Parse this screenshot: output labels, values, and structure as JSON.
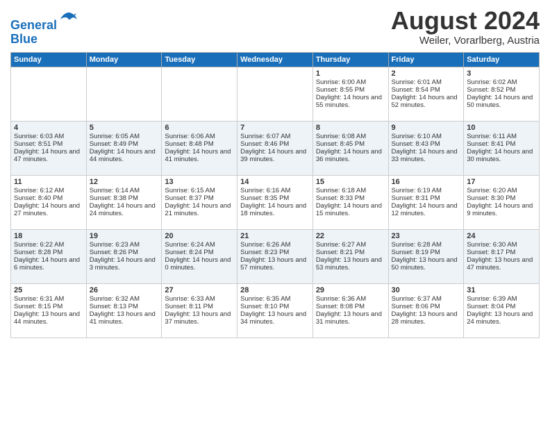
{
  "header": {
    "logo_line1": "General",
    "logo_line2": "Blue",
    "month": "August 2024",
    "location": "Weiler, Vorarlberg, Austria"
  },
  "days_of_week": [
    "Sunday",
    "Monday",
    "Tuesday",
    "Wednesday",
    "Thursday",
    "Friday",
    "Saturday"
  ],
  "weeks": [
    [
      {
        "day": "",
        "empty": true
      },
      {
        "day": "",
        "empty": true
      },
      {
        "day": "",
        "empty": true
      },
      {
        "day": "",
        "empty": true
      },
      {
        "day": "1",
        "sunrise": "Sunrise: 6:00 AM",
        "sunset": "Sunset: 8:55 PM",
        "daylight": "Daylight: 14 hours and 55 minutes."
      },
      {
        "day": "2",
        "sunrise": "Sunrise: 6:01 AM",
        "sunset": "Sunset: 8:54 PM",
        "daylight": "Daylight: 14 hours and 52 minutes."
      },
      {
        "day": "3",
        "sunrise": "Sunrise: 6:02 AM",
        "sunset": "Sunset: 8:52 PM",
        "daylight": "Daylight: 14 hours and 50 minutes."
      }
    ],
    [
      {
        "day": "4",
        "sunrise": "Sunrise: 6:03 AM",
        "sunset": "Sunset: 8:51 PM",
        "daylight": "Daylight: 14 hours and 47 minutes."
      },
      {
        "day": "5",
        "sunrise": "Sunrise: 6:05 AM",
        "sunset": "Sunset: 8:49 PM",
        "daylight": "Daylight: 14 hours and 44 minutes."
      },
      {
        "day": "6",
        "sunrise": "Sunrise: 6:06 AM",
        "sunset": "Sunset: 8:48 PM",
        "daylight": "Daylight: 14 hours and 41 minutes."
      },
      {
        "day": "7",
        "sunrise": "Sunrise: 6:07 AM",
        "sunset": "Sunset: 8:46 PM",
        "daylight": "Daylight: 14 hours and 39 minutes."
      },
      {
        "day": "8",
        "sunrise": "Sunrise: 6:08 AM",
        "sunset": "Sunset: 8:45 PM",
        "daylight": "Daylight: 14 hours and 36 minutes."
      },
      {
        "day": "9",
        "sunrise": "Sunrise: 6:10 AM",
        "sunset": "Sunset: 8:43 PM",
        "daylight": "Daylight: 14 hours and 33 minutes."
      },
      {
        "day": "10",
        "sunrise": "Sunrise: 6:11 AM",
        "sunset": "Sunset: 8:41 PM",
        "daylight": "Daylight: 14 hours and 30 minutes."
      }
    ],
    [
      {
        "day": "11",
        "sunrise": "Sunrise: 6:12 AM",
        "sunset": "Sunset: 8:40 PM",
        "daylight": "Daylight: 14 hours and 27 minutes."
      },
      {
        "day": "12",
        "sunrise": "Sunrise: 6:14 AM",
        "sunset": "Sunset: 8:38 PM",
        "daylight": "Daylight: 14 hours and 24 minutes."
      },
      {
        "day": "13",
        "sunrise": "Sunrise: 6:15 AM",
        "sunset": "Sunset: 8:37 PM",
        "daylight": "Daylight: 14 hours and 21 minutes."
      },
      {
        "day": "14",
        "sunrise": "Sunrise: 6:16 AM",
        "sunset": "Sunset: 8:35 PM",
        "daylight": "Daylight: 14 hours and 18 minutes."
      },
      {
        "day": "15",
        "sunrise": "Sunrise: 6:18 AM",
        "sunset": "Sunset: 8:33 PM",
        "daylight": "Daylight: 14 hours and 15 minutes."
      },
      {
        "day": "16",
        "sunrise": "Sunrise: 6:19 AM",
        "sunset": "Sunset: 8:31 PM",
        "daylight": "Daylight: 14 hours and 12 minutes."
      },
      {
        "day": "17",
        "sunrise": "Sunrise: 6:20 AM",
        "sunset": "Sunset: 8:30 PM",
        "daylight": "Daylight: 14 hours and 9 minutes."
      }
    ],
    [
      {
        "day": "18",
        "sunrise": "Sunrise: 6:22 AM",
        "sunset": "Sunset: 8:28 PM",
        "daylight": "Daylight: 14 hours and 6 minutes."
      },
      {
        "day": "19",
        "sunrise": "Sunrise: 6:23 AM",
        "sunset": "Sunset: 8:26 PM",
        "daylight": "Daylight: 14 hours and 3 minutes."
      },
      {
        "day": "20",
        "sunrise": "Sunrise: 6:24 AM",
        "sunset": "Sunset: 8:24 PM",
        "daylight": "Daylight: 14 hours and 0 minutes."
      },
      {
        "day": "21",
        "sunrise": "Sunrise: 6:26 AM",
        "sunset": "Sunset: 8:23 PM",
        "daylight": "Daylight: 13 hours and 57 minutes."
      },
      {
        "day": "22",
        "sunrise": "Sunrise: 6:27 AM",
        "sunset": "Sunset: 8:21 PM",
        "daylight": "Daylight: 13 hours and 53 minutes."
      },
      {
        "day": "23",
        "sunrise": "Sunrise: 6:28 AM",
        "sunset": "Sunset: 8:19 PM",
        "daylight": "Daylight: 13 hours and 50 minutes."
      },
      {
        "day": "24",
        "sunrise": "Sunrise: 6:30 AM",
        "sunset": "Sunset: 8:17 PM",
        "daylight": "Daylight: 13 hours and 47 minutes."
      }
    ],
    [
      {
        "day": "25",
        "sunrise": "Sunrise: 6:31 AM",
        "sunset": "Sunset: 8:15 PM",
        "daylight": "Daylight: 13 hours and 44 minutes."
      },
      {
        "day": "26",
        "sunrise": "Sunrise: 6:32 AM",
        "sunset": "Sunset: 8:13 PM",
        "daylight": "Daylight: 13 hours and 41 minutes."
      },
      {
        "day": "27",
        "sunrise": "Sunrise: 6:33 AM",
        "sunset": "Sunset: 8:11 PM",
        "daylight": "Daylight: 13 hours and 37 minutes."
      },
      {
        "day": "28",
        "sunrise": "Sunrise: 6:35 AM",
        "sunset": "Sunset: 8:10 PM",
        "daylight": "Daylight: 13 hours and 34 minutes."
      },
      {
        "day": "29",
        "sunrise": "Sunrise: 6:36 AM",
        "sunset": "Sunset: 8:08 PM",
        "daylight": "Daylight: 13 hours and 31 minutes."
      },
      {
        "day": "30",
        "sunrise": "Sunrise: 6:37 AM",
        "sunset": "Sunset: 8:06 PM",
        "daylight": "Daylight: 13 hours and 28 minutes."
      },
      {
        "day": "31",
        "sunrise": "Sunrise: 6:39 AM",
        "sunset": "Sunset: 8:04 PM",
        "daylight": "Daylight: 13 hours and 24 minutes."
      }
    ]
  ]
}
